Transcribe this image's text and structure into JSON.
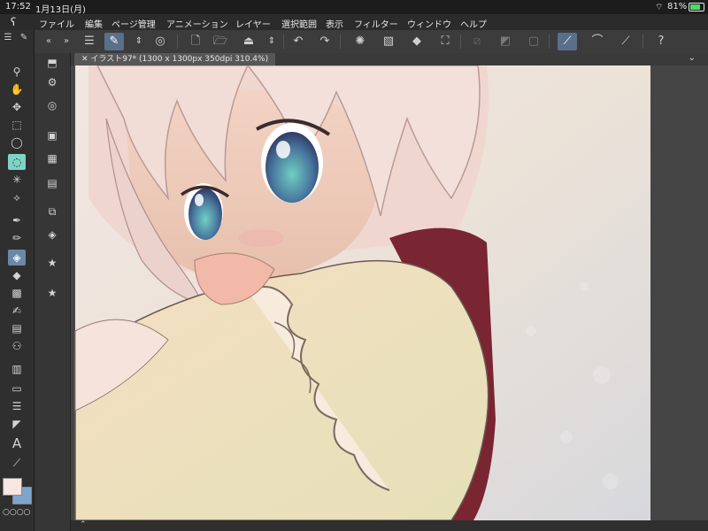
{
  "status": {
    "time": "17:52",
    "date": "1月13日(月)",
    "battery": "81%",
    "wifi_icon": "wifi-icon",
    "battery_icon": "battery-icon"
  },
  "menu": [
    "ファイル",
    "編集",
    "ページ管理",
    "アニメーション",
    "レイヤー",
    "選択範囲",
    "表示",
    "フィルター",
    "ウィンドウ",
    "ヘルプ"
  ],
  "document": {
    "tab_label": "イラスト97* (1300 x 1300px 350dpi 310.4%)"
  },
  "palette": {
    "main_color": "#fbe5e0",
    "sub_color": "#7ea5cc",
    "accent": "#7fd3c7",
    "selected": "#6c87a8"
  }
}
